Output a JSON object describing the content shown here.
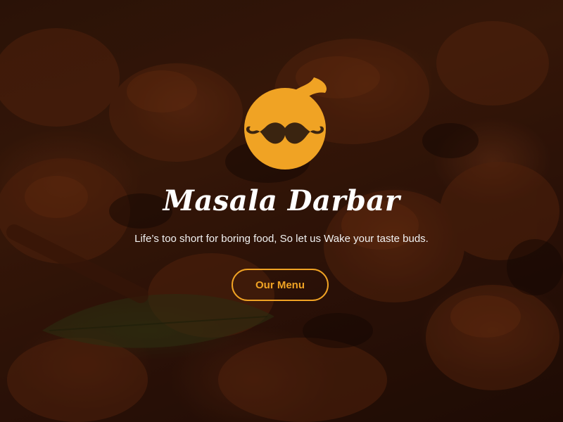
{
  "brand": {
    "name": "Masala Darbar",
    "tagline": "Life’s too short for boring food, So let us Wake your taste buds.",
    "logo_icon": "mustache-face-logo-icon"
  },
  "hero": {
    "background": "dark curry dish photograph",
    "cta_label": "Our Menu"
  },
  "colors": {
    "accent": "#f0a324",
    "text": "#ffffff",
    "logo_mustache": "#3a2410"
  }
}
